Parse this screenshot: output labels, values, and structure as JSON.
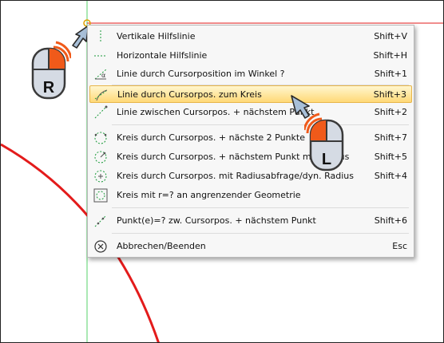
{
  "menu": {
    "items": [
      {
        "label": "Vertikale Hilfslinie",
        "shortcut": "Shift+V",
        "icon": "vertical-guideline-icon"
      },
      {
        "label": "Horizontale Hilfslinie",
        "shortcut": "Shift+H",
        "icon": "horizontal-guideline-icon"
      },
      {
        "label": "Linie durch Cursorposition im Winkel ?",
        "shortcut": "Shift+1",
        "icon": "angle-line-icon"
      },
      {
        "label": "Linie durch Cursorpos. zum Kreis",
        "shortcut": "Shift+3",
        "icon": "line-to-circle-icon",
        "highlighted": true
      },
      {
        "label": "Linie zwischen Cursorpos. + nächstem Punkt",
        "shortcut": "Shift+2",
        "icon": "line-to-point-icon"
      },
      {
        "label": "Kreis durch Cursorpos. + nächste 2 Punkte",
        "shortcut": "Shift+7",
        "icon": "circle-three-points-icon"
      },
      {
        "label": "Kreis durch Cursorpos. + nächstem Punkt mit Radius",
        "shortcut": "Shift+5",
        "icon": "circle-point-radius-icon"
      },
      {
        "label": "Kreis durch Cursorpos. mit Radiusabfrage/dyn. Radius",
        "shortcut": "Shift+4",
        "icon": "circle-radius-icon"
      },
      {
        "label": "Kreis mit r=? an angrenzender Geometrie",
        "shortcut": "",
        "icon": "tangent-circle-icon"
      },
      {
        "label": "Punkt(e)=? zw. Cursorpos. + nächstem Punkt",
        "shortcut": "Shift+6",
        "icon": "points-between-icon"
      },
      {
        "label": "Abbrechen/Beenden",
        "shortcut": "Esc",
        "icon": "cancel-circle-icon"
      }
    ]
  },
  "mouse_hints": {
    "right_button_letter": "R",
    "left_button_letter": "L"
  },
  "colors": {
    "highlight": "#ffd977",
    "curve": "#e31b1b",
    "guideline_vertical": "#55d16a",
    "guideline_horizontal": "#e31b1b",
    "mouse_accent": "#f05a1a"
  }
}
